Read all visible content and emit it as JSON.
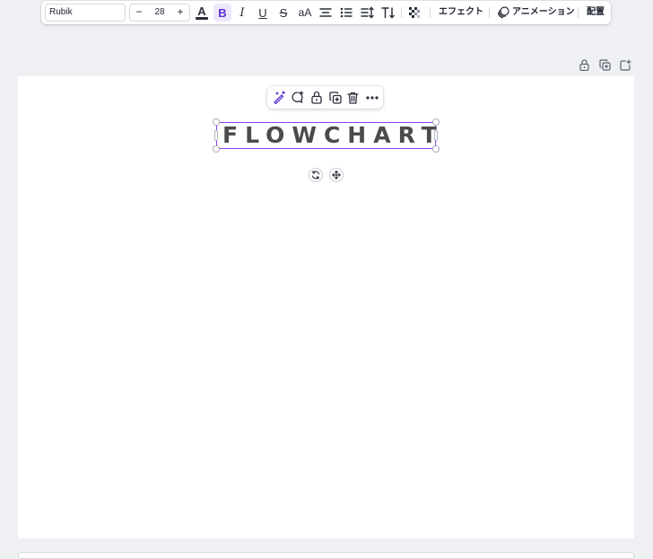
{
  "toolbar": {
    "font_family": "Rubik",
    "font_size_decrease": "−",
    "font_size": "28",
    "font_size_increase": "+",
    "text_color_glyph": "A",
    "text_color_value": "#2a2e3a",
    "bold_glyph": "B",
    "italic_glyph": "I",
    "underline_glyph": "U",
    "strikethrough_glyph": "S",
    "case_glyph": "aA",
    "effects_label": "エフェクト",
    "animation_label": "アニメーション",
    "position_label": "配置"
  },
  "page_actions": {
    "icons": [
      "lock-icon",
      "duplicate-page-icon",
      "add-page-icon"
    ]
  },
  "context_menu": {
    "icons": [
      "magic-write-icon",
      "comment-icon",
      "lock-icon",
      "duplicate-icon",
      "delete-icon",
      "more-icon"
    ]
  },
  "canvas": {
    "headline_text": "FLOWCHART"
  },
  "element_controls": {
    "icons": [
      "rotate-icon",
      "move-icon"
    ]
  },
  "colors": {
    "accent": "#8b3dff",
    "active_button_bg": "#ece6fb",
    "headline_color": "#4b4b4b",
    "workspace_bg": "#eff0f4"
  }
}
